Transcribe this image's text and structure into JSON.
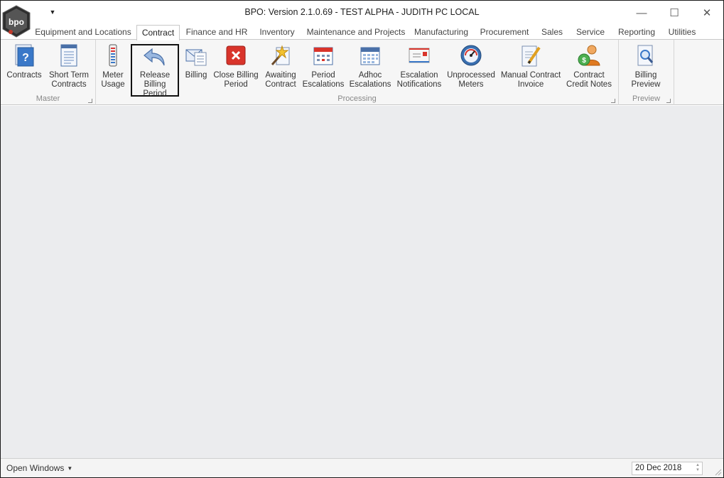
{
  "window": {
    "title": "BPO: Version 2.1.0.69 - TEST ALPHA - JUDITH PC LOCAL",
    "logo_text": "bpo",
    "controls": {
      "minimize": "—",
      "maximize": "☐",
      "close": "✕"
    }
  },
  "quick_access": {
    "arrow": "▼"
  },
  "tabs": [
    {
      "label": "Equipment and Locations",
      "active": false
    },
    {
      "label": "Contract",
      "active": true
    },
    {
      "label": "Finance and HR",
      "active": false
    },
    {
      "label": "Inventory",
      "active": false
    },
    {
      "label": "Maintenance and Projects",
      "active": false
    },
    {
      "label": "Manufacturing",
      "active": false
    },
    {
      "label": "Procurement",
      "active": false
    },
    {
      "label": "Sales",
      "active": false
    },
    {
      "label": "Service",
      "active": false
    },
    {
      "label": "Reporting",
      "active": false
    },
    {
      "label": "Utilities",
      "active": false
    }
  ],
  "ribbon": {
    "groups": [
      {
        "label": "Master",
        "buttons": [
          {
            "label": "Contracts",
            "icon": "contract-help-icon"
          },
          {
            "label": "Short Term\nContracts",
            "icon": "document-icon"
          }
        ]
      },
      {
        "label": "Processing",
        "buttons": [
          {
            "label": "Meter\nUsage",
            "icon": "meter-icon"
          },
          {
            "label": "Release\nBilling Period",
            "icon": "undo-arrow-icon",
            "selected": true
          },
          {
            "label": "Billing",
            "icon": "billing-icon"
          },
          {
            "label": "Close Billing\nPeriod",
            "icon": "close-red-icon"
          },
          {
            "label": "Awaiting\nContract",
            "icon": "wand-icon"
          },
          {
            "label": "Period\nEscalations",
            "icon": "calendar-icon"
          },
          {
            "label": "Adhoc\nEscalations",
            "icon": "calendar-grid-icon"
          },
          {
            "label": "Escalation\nNotifications",
            "icon": "envelope-icon"
          },
          {
            "label": "Unprocessed\nMeters",
            "icon": "gauge-icon"
          },
          {
            "label": "Manual Contract\nInvoice",
            "icon": "edit-document-icon"
          },
          {
            "label": "Contract\nCredit Notes",
            "icon": "user-credit-icon"
          }
        ]
      },
      {
        "label": "Preview",
        "buttons": [
          {
            "label": "Billing\nPreview",
            "icon": "magnifier-document-icon"
          }
        ]
      }
    ]
  },
  "statusbar": {
    "open_windows": "Open Windows",
    "caret": "▼",
    "date": "20 Dec 2018"
  },
  "colors": {
    "main_background": "#ebecee",
    "ribbon_background": "#f6f6f6",
    "close_red": "#d9342b",
    "accent_blue": "#3a78c8"
  }
}
